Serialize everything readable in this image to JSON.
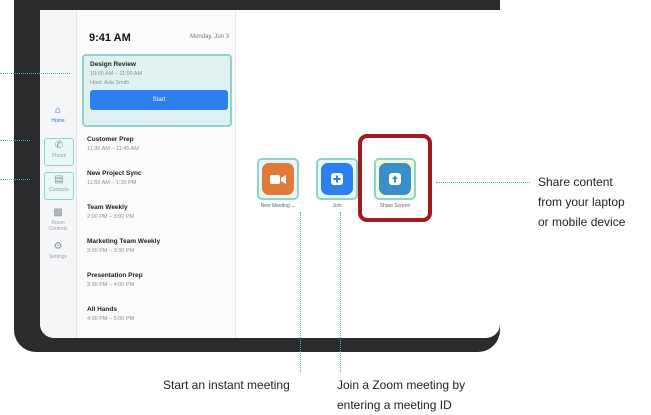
{
  "status_bar": {
    "indicators": "wifi-battery"
  },
  "header": {
    "time": "9:41 AM",
    "date": "Monday, Jun 3"
  },
  "nav_rail": [
    {
      "icon": "home-icon",
      "label": "Home",
      "active": true
    },
    {
      "icon": "phone-icon",
      "label": "Phone"
    },
    {
      "icon": "contacts-icon",
      "label": "Contacts"
    },
    {
      "icon": "room-controls-icon",
      "label": "Room Controls"
    },
    {
      "icon": "settings-icon",
      "label": "Settings"
    }
  ],
  "current_meeting": {
    "title": "Design Review",
    "time": "10:00 AM – 11:00 AM",
    "host": "Host: Ada Smith",
    "start_label": "Start"
  },
  "meetings": [
    {
      "title": "Customer Prep",
      "time": "11:30 AM – 11:45 AM"
    },
    {
      "title": "New Project Sync",
      "time": "11:50 AM – 1:30 PM"
    },
    {
      "title": "Team Weekly",
      "time": "2:00 PM – 3:00 PM"
    },
    {
      "title": "Marketing Team Weekly",
      "time": "3:00 PM – 3:30 PM"
    },
    {
      "title": "Presentation Prep",
      "time": "3:30 PM – 4:00 PM"
    },
    {
      "title": "All Hands",
      "time": "4:00 PM – 5:00 PM"
    }
  ],
  "actions": {
    "new_meeting": {
      "label": "New Meeting",
      "icon": "video-camera-icon",
      "color": "#e07a3b"
    },
    "join": {
      "label": "Join",
      "icon": "plus-icon",
      "color": "#2d7ff0"
    },
    "share_screen": {
      "label": "Share Screen",
      "icon": "share-arrow-icon",
      "color": "#3a8fc9"
    }
  },
  "callouts": {
    "share": [
      "Share content",
      "from your laptop",
      "or mobile device"
    ],
    "new_meeting": "Start an instant meeting",
    "join": [
      "Join a Zoom meeting by",
      "entering a meeting ID"
    ]
  },
  "colors": {
    "accent": "#2d7ff0",
    "highlight": "#8fd3cf",
    "guide": "#3fb6b0",
    "emphasis": "#a4191c"
  }
}
